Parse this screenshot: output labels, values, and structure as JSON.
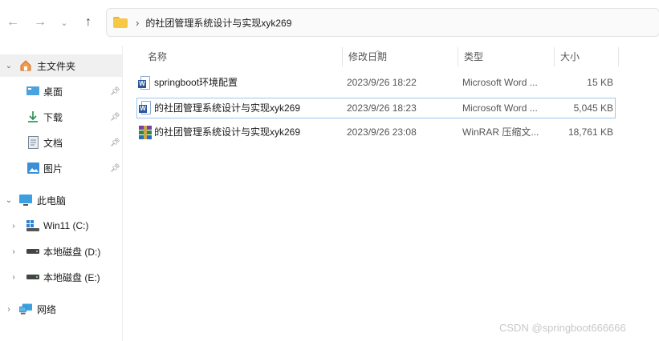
{
  "toolbar": {
    "back_icon": "arrow-left-icon",
    "forward_icon": "arrow-right-icon",
    "recent_icon": "chevron-down-icon",
    "up_icon": "arrow-up-icon",
    "address_path": "的社团管理系统设计与实现xyk269"
  },
  "sidebar": {
    "home": "主文件夹",
    "quick": [
      {
        "label": "桌面",
        "icon": "desktop-icon"
      },
      {
        "label": "下载",
        "icon": "download-icon"
      },
      {
        "label": "文档",
        "icon": "document-icon"
      },
      {
        "label": "图片",
        "icon": "picture-icon"
      }
    ],
    "this_pc": "此电脑",
    "drives": [
      {
        "label": "Win11 (C:)"
      },
      {
        "label": "本地磁盘 (D:)"
      },
      {
        "label": "本地磁盘 (E:)"
      }
    ],
    "network": "网络"
  },
  "columns": {
    "name": "名称",
    "modified": "修改日期",
    "type": "类型",
    "size": "大小"
  },
  "files": [
    {
      "name": "springboot环境配置",
      "modified": "2023/9/26 18:22",
      "type": "Microsoft Word ...",
      "size": "15 KB",
      "icon": "word-icon"
    },
    {
      "name": "的社团管理系统设计与实现xyk269",
      "modified": "2023/9/26 18:23",
      "type": "Microsoft Word ...",
      "size": "5,045 KB",
      "icon": "word-icon"
    },
    {
      "name": "的社团管理系统设计与实现xyk269",
      "modified": "2023/9/26 23:08",
      "type": "WinRAR 压缩文...",
      "size": "18,761 KB",
      "icon": "rar-icon"
    }
  ],
  "watermark": "CSDN @springboot666666",
  "colors": {
    "selection_border": "#99c9ef",
    "folder": "#f7c844",
    "word": "#2b579a"
  }
}
